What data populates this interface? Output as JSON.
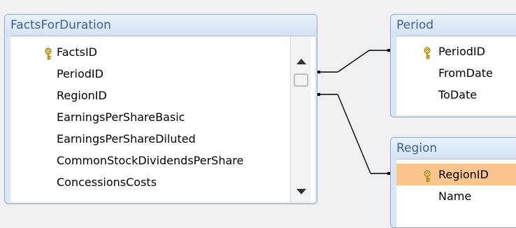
{
  "tables": {
    "facts": {
      "title": "FactsForDuration",
      "fields": [
        {
          "label": "FactsID",
          "key": true
        },
        {
          "label": "PeriodID",
          "key": false
        },
        {
          "label": "RegionID",
          "key": false
        },
        {
          "label": "EarningsPerShareBasic",
          "key": false
        },
        {
          "label": "EarningsPerShareDiluted",
          "key": false
        },
        {
          "label": "CommonStockDividendsPerShare",
          "key": false
        },
        {
          "label": "ConcessionsCosts",
          "key": false
        }
      ]
    },
    "period": {
      "title": "Period",
      "fields": [
        {
          "label": "PeriodID",
          "key": true
        },
        {
          "label": "FromDate",
          "key": false
        },
        {
          "label": "ToDate",
          "key": false
        }
      ]
    },
    "region": {
      "title": "Region",
      "fields": [
        {
          "label": "RegionID",
          "key": true,
          "selected": true
        },
        {
          "label": "Name",
          "key": false
        }
      ]
    }
  },
  "colors": {
    "frame": "#d9e6f5",
    "title_text": "#3f5f86",
    "selection": "#f9c58d",
    "key_icon": "#d4a017"
  },
  "icons": [
    "key-icon",
    "scroll-up-arrow-icon",
    "scroll-down-arrow-icon"
  ]
}
